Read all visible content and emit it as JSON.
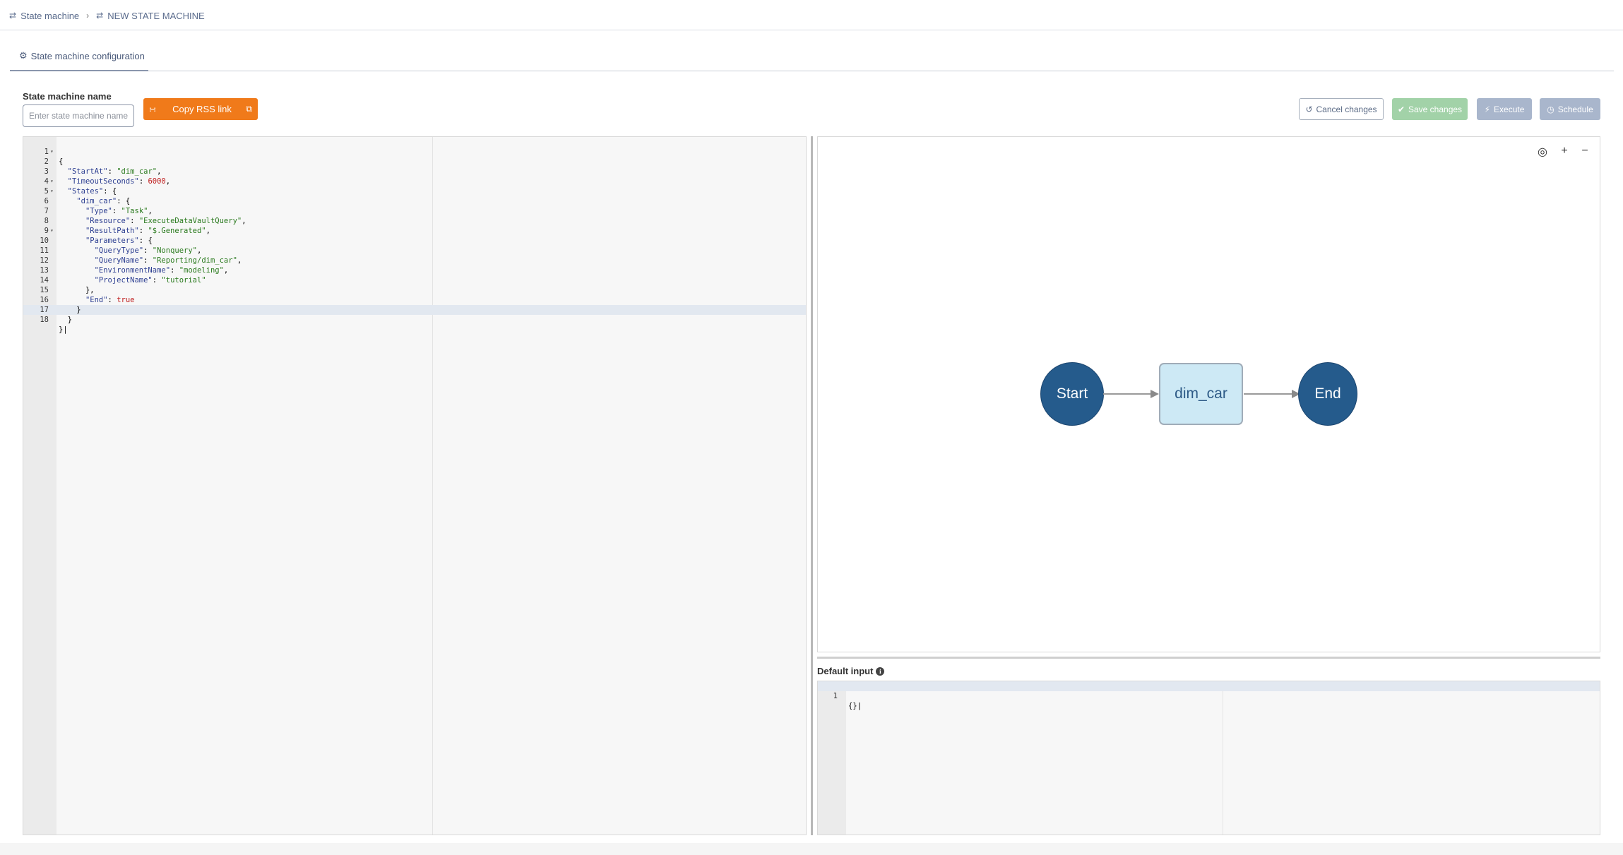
{
  "breadcrumb": {
    "items": [
      {
        "label": "State machine",
        "icon": "state-machine-icon"
      },
      {
        "label": "NEW STATE MACHINE",
        "icon": "state-machine-icon"
      }
    ]
  },
  "tabs": {
    "active": {
      "label": "State machine configuration",
      "icon": "gear-icon"
    }
  },
  "form": {
    "name_label": "State machine name",
    "name_placeholder": "Enter state machine name",
    "name_value": "",
    "rss_button": "Copy RSS link"
  },
  "toolbar": {
    "cancel": "Cancel changes",
    "save": "Save changes",
    "execute": "Execute",
    "schedule": "Schedule"
  },
  "editor": {
    "lines": [
      {
        "n": "1",
        "fold": true
      },
      {
        "n": "2",
        "fold": false
      },
      {
        "n": "3",
        "fold": false
      },
      {
        "n": "4",
        "fold": true
      },
      {
        "n": "5",
        "fold": true
      },
      {
        "n": "6",
        "fold": false
      },
      {
        "n": "7",
        "fold": false
      },
      {
        "n": "8",
        "fold": false
      },
      {
        "n": "9",
        "fold": true
      },
      {
        "n": "10",
        "fold": false
      },
      {
        "n": "11",
        "fold": false
      },
      {
        "n": "12",
        "fold": false
      },
      {
        "n": "13",
        "fold": false
      },
      {
        "n": "14",
        "fold": false
      },
      {
        "n": "15",
        "fold": false
      },
      {
        "n": "16",
        "fold": false
      },
      {
        "n": "17",
        "fold": false
      },
      {
        "n": "18",
        "fold": false
      }
    ],
    "code": {
      "l1": "{",
      "l2_key": "\"StartAt\"",
      "l2_val": "\"dim_car\"",
      "l3_key": "\"TimeoutSeconds\"",
      "l3_val": "6000",
      "l4_key": "\"States\"",
      "l5_key": "\"dim_car\"",
      "l6_key": "\"Type\"",
      "l6_val": "\"Task\"",
      "l7_key": "\"Resource\"",
      "l7_val": "\"ExecuteDataVaultQuery\"",
      "l8_key": "\"ResultPath\"",
      "l8_val": "\"$.Generated\"",
      "l9_key": "\"Parameters\"",
      "l10_key": "\"QueryType\"",
      "l10_val": "\"Nonquery\"",
      "l11_key": "\"QueryName\"",
      "l11_val": "\"Reporting/dim_car\"",
      "l12_key": "\"EnvironmentName\"",
      "l12_val": "\"modeling\"",
      "l13_key": "\"ProjectName\"",
      "l13_val": "\"tutorial\"",
      "l14": "},",
      "l15_key": "\"End\"",
      "l15_val": "true",
      "l16": "}",
      "l17": "}",
      "l18": "}"
    }
  },
  "graph": {
    "controls": [
      "target-icon",
      "zoom-in-icon",
      "zoom-out-icon"
    ],
    "nodes": {
      "start": "Start",
      "task": "dim_car",
      "end": "End"
    }
  },
  "default_input": {
    "label": "Default input",
    "line": "1",
    "value": "{}"
  },
  "colors": {
    "accent_orange": "#f07a1a",
    "save_green": "#a2d2a8",
    "disabled_blue": "#a9b6cc",
    "node_dark": "#255b8c",
    "node_light": "#cde9f5"
  }
}
